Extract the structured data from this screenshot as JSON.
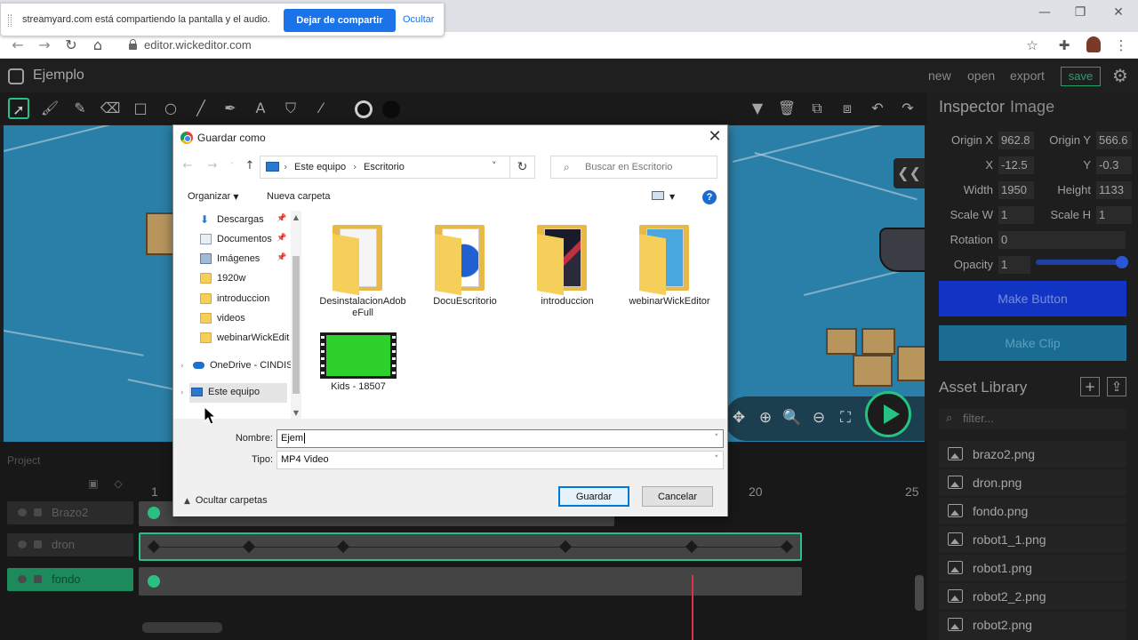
{
  "browser": {
    "url": "editor.wickeditor.com",
    "share_banner": {
      "text": "streamyard.com está compartiendo la pantalla y el audio.",
      "stop_label": "Dejar de compartir",
      "hide_label": "Ocultar"
    }
  },
  "app": {
    "title": "Ejemplo",
    "menu": {
      "new": "new",
      "open": "open",
      "export": "export",
      "save": "save"
    }
  },
  "inspector": {
    "title": "Inspector",
    "subtitle": "Image",
    "origin_x_label": "Origin X",
    "origin_x": "962.8",
    "origin_y_label": "Origin Y",
    "origin_y": "566.6",
    "x_label": "X",
    "x": "-12.5",
    "y_label": "Y",
    "y": "-0.3",
    "width_label": "Width",
    "width": "1950",
    "height_label": "Height",
    "height": "1133",
    "scale_w_label": "Scale W",
    "scale_w": "1",
    "scale_h_label": "Scale H",
    "scale_h": "1",
    "rotation_label": "Rotation",
    "rotation": "0",
    "opacity_label": "Opacity",
    "opacity": "1",
    "opacity_level": 1.0,
    "make_button": "Make Button",
    "make_clip": "Make Clip"
  },
  "assets": {
    "title": "Asset Library",
    "filter_placeholder": "filter...",
    "items": [
      "brazo2.png",
      "dron.png",
      "fondo.png",
      "robot1_1.png",
      "robot1.png",
      "robot2_2.png",
      "robot2.png"
    ]
  },
  "timeline": {
    "project_label": "Project",
    "frame_numbers": [
      "1",
      "20",
      "25"
    ],
    "layers": [
      {
        "name": "Brazo2"
      },
      {
        "name": "dron"
      },
      {
        "name": "fondo"
      }
    ]
  },
  "dialog": {
    "title": "Guardar como",
    "breadcrumb": [
      "Este equipo",
      "Escritorio"
    ],
    "search_placeholder": "Buscar en Escritorio",
    "organize": "Organizar",
    "new_folder": "Nueva carpeta",
    "nav_items": [
      {
        "label": "Descargas",
        "icon": "download-icon"
      },
      {
        "label": "Documentos",
        "icon": "documents-icon"
      },
      {
        "label": "Imágenes",
        "icon": "images-icon"
      },
      {
        "label": "1920w",
        "icon": "folder-icon"
      },
      {
        "label": "introduccion",
        "icon": "folder-icon"
      },
      {
        "label": "videos",
        "icon": "folder-icon"
      },
      {
        "label": "webinarWickEdit",
        "icon": "folder-icon"
      },
      {
        "label": "OneDrive - CINDIS",
        "icon": "onedrive-icon"
      },
      {
        "label": "Este equipo",
        "icon": "computer-icon"
      }
    ],
    "files": [
      {
        "name": "DesinstalacionAdobeFull",
        "type": "folder"
      },
      {
        "name": "DocuEscritorio",
        "type": "folder"
      },
      {
        "name": "introduccion",
        "type": "folder"
      },
      {
        "name": "webinarWickEditor",
        "type": "folder"
      },
      {
        "name": "Kids - 18507",
        "type": "video"
      }
    ],
    "filename_label": "Nombre:",
    "filename_value": "Ejem",
    "type_label": "Tipo:",
    "type_value": "MP4 Video",
    "hide_folders": "Ocultar carpetas",
    "save": "Guardar",
    "cancel": "Cancelar"
  }
}
